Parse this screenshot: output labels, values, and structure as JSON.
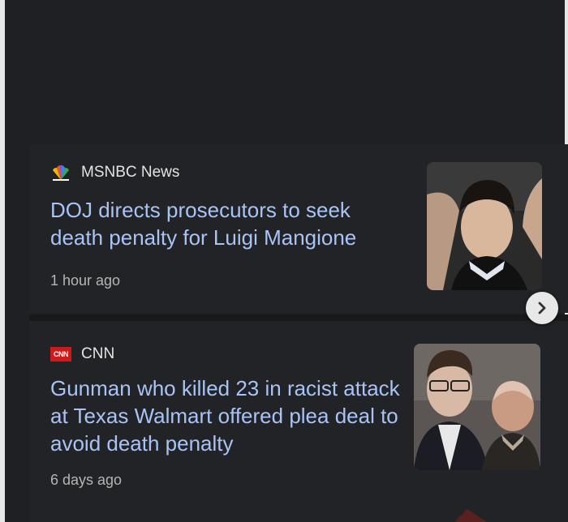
{
  "articles": [
    {
      "source": "MSNBC News",
      "source_icon": "msnbc-peacock-icon",
      "headline": "DOJ directs prosecutors to seek death penalty for Luigi Mangione",
      "time": "1 hour ago",
      "thumbnail": "news-photo"
    },
    {
      "source": "CNN",
      "source_icon": "cnn-logo-icon",
      "logo_text": "CNN",
      "headline": "Gunman who killed 23 in racist attack at Texas Walmart offered plea deal to avoid death penalty",
      "time": "6 days ago",
      "thumbnail": "news-photo"
    }
  ],
  "controls": {
    "next_icon": "chevron-right-icon"
  },
  "colors": {
    "background": "#1f2023",
    "headline": "#a8c3f5",
    "cnn_red": "#cc1b1b"
  }
}
